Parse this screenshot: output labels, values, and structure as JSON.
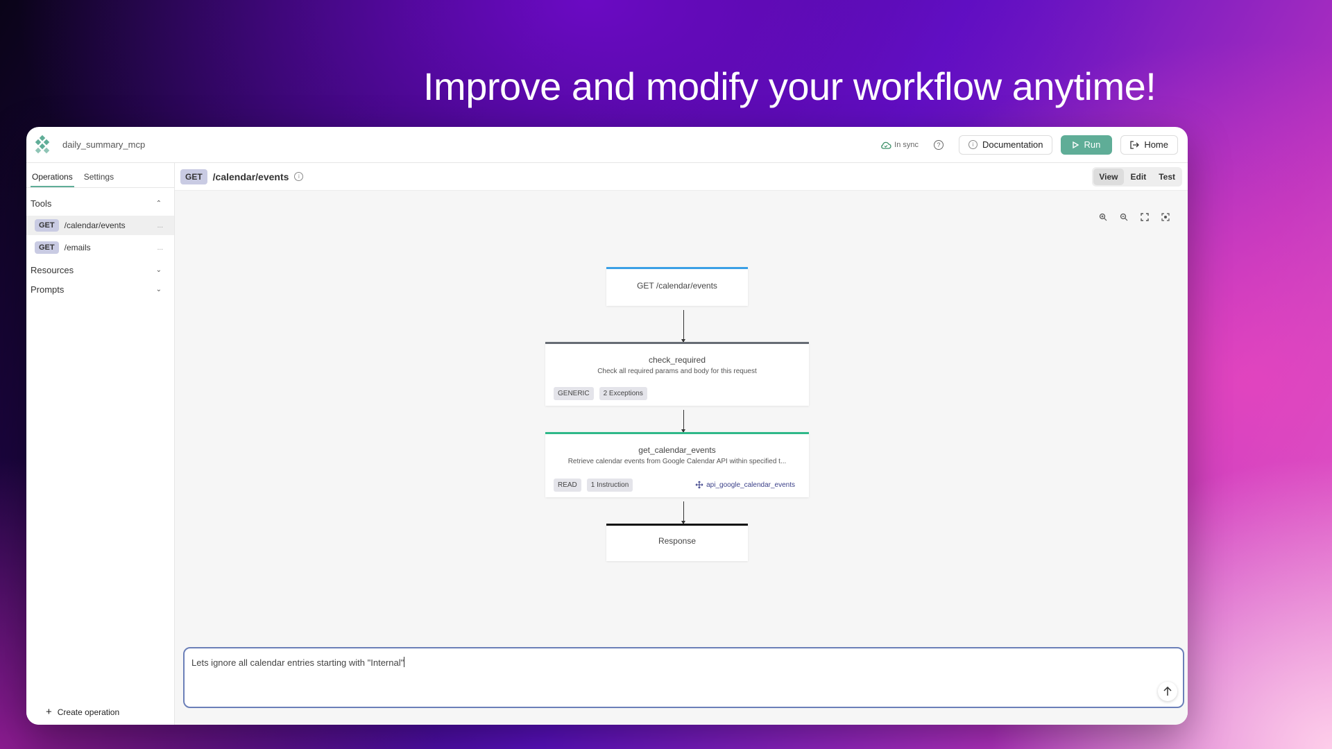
{
  "headline": "Improve and modify your workflow anytime!",
  "app": {
    "name": "daily_summary_mcp"
  },
  "topbar": {
    "sync_status": "In sync",
    "help_icon": "?",
    "documentation_label": "Documentation",
    "run_label": "Run",
    "home_label": "Home"
  },
  "sidebar": {
    "tabs": [
      {
        "label": "Operations",
        "active": true
      },
      {
        "label": "Settings",
        "active": false
      }
    ],
    "tools_label": "Tools",
    "tools": [
      {
        "method": "GET",
        "path": "/calendar/events",
        "selected": true
      },
      {
        "method": "GET",
        "path": "/emails",
        "selected": false
      }
    ],
    "resources_label": "Resources",
    "prompts_label": "Prompts",
    "create_label": "Create operation",
    "more_glyph": "..."
  },
  "main": {
    "method": "GET",
    "route": "/calendar/events",
    "modes": [
      {
        "label": "View",
        "active": true
      },
      {
        "label": "Edit",
        "active": false
      },
      {
        "label": "Test",
        "active": false
      }
    ]
  },
  "flow": {
    "start": {
      "label": "GET /calendar/events",
      "accent": "#3aa0e6"
    },
    "check": {
      "title": "check_required",
      "desc": "Check all required params and body for this request",
      "chips": [
        "GENERIC",
        "2 Exceptions"
      ],
      "accent": "#666c74"
    },
    "get_events": {
      "title": "get_calendar_events",
      "desc": "Retrieve calendar events from Google Calendar API within specified t...",
      "chips": [
        "READ",
        "1 Instruction"
      ],
      "api": "api_google_calendar_events",
      "accent": "#2fb889"
    },
    "response": {
      "label": "Response",
      "accent": "#111111"
    }
  },
  "chat": {
    "text": "Lets ignore all calendar entries starting with \"Internal\""
  },
  "colors": {
    "brand": "#5fad97",
    "badge": "#c9cbe3"
  }
}
